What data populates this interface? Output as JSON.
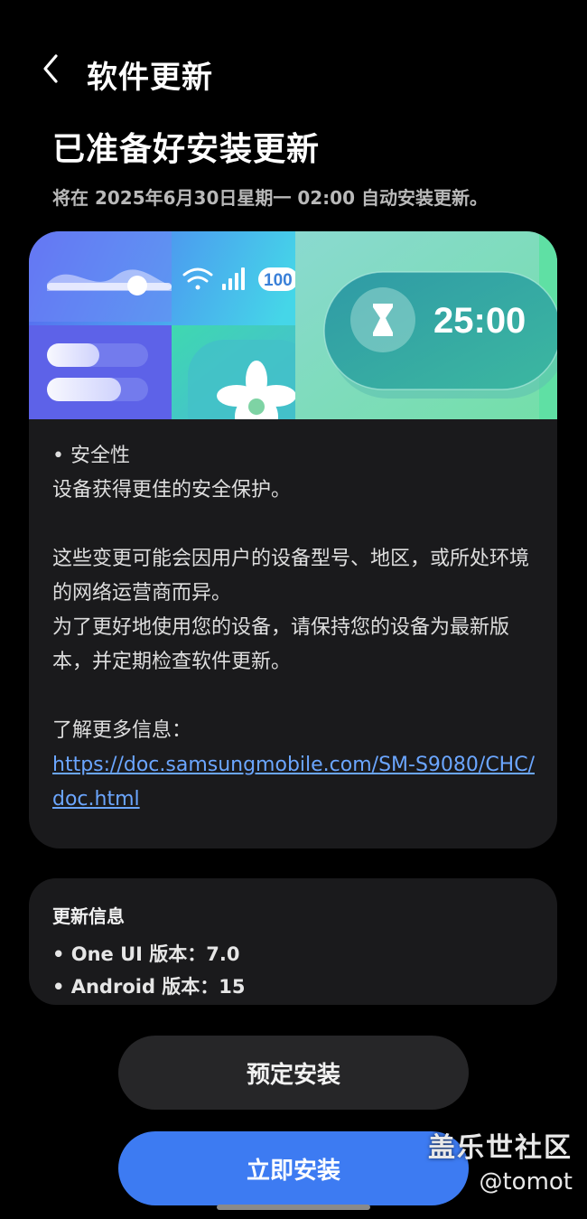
{
  "header": {
    "title": "软件更新",
    "back_icon": "chevron-left-icon"
  },
  "status": {
    "title": "已准备好安装更新",
    "schedule_text": "将在 2025年6月30日星期一 02:00 自动安装更新。"
  },
  "banner": {
    "battery_text": "100",
    "timer_text": "25:00",
    "colors": {
      "left_gradient_start": "#5c6ff2",
      "left_gradient_end": "#3fd3e6",
      "right_gradient_start": "#7fd8c8",
      "right_gradient_end": "#6be0a0"
    }
  },
  "changelog": {
    "security_heading": "• 安全性",
    "security_desc": "设备获得更佳的安全保护。",
    "disclaimer_1": "这些变更可能会因用户的设备型号、地区，或所处环境的网络运营商而异。",
    "disclaimer_2": "为了更好地使用您的设备，请保持您的设备为最新版本，并定期检查软件更新。",
    "more_info_label": "了解更多信息：",
    "more_info_link": "https://doc.samsungmobile.com/SM-S9080/CHC/doc.html"
  },
  "update_info": {
    "title": "更新信息",
    "items": [
      "• One UI 版本：7.0",
      "• Android 版本：15"
    ]
  },
  "buttons": {
    "schedule_label": "预定安装",
    "install_label": "立即安装"
  },
  "watermark": {
    "line1": "盖乐世社区",
    "line2": "@tomot"
  },
  "colors": {
    "background": "#000000",
    "card": "#1a1a1c",
    "accent_blue": "#3d7bf2",
    "link": "#6ba6ff"
  }
}
